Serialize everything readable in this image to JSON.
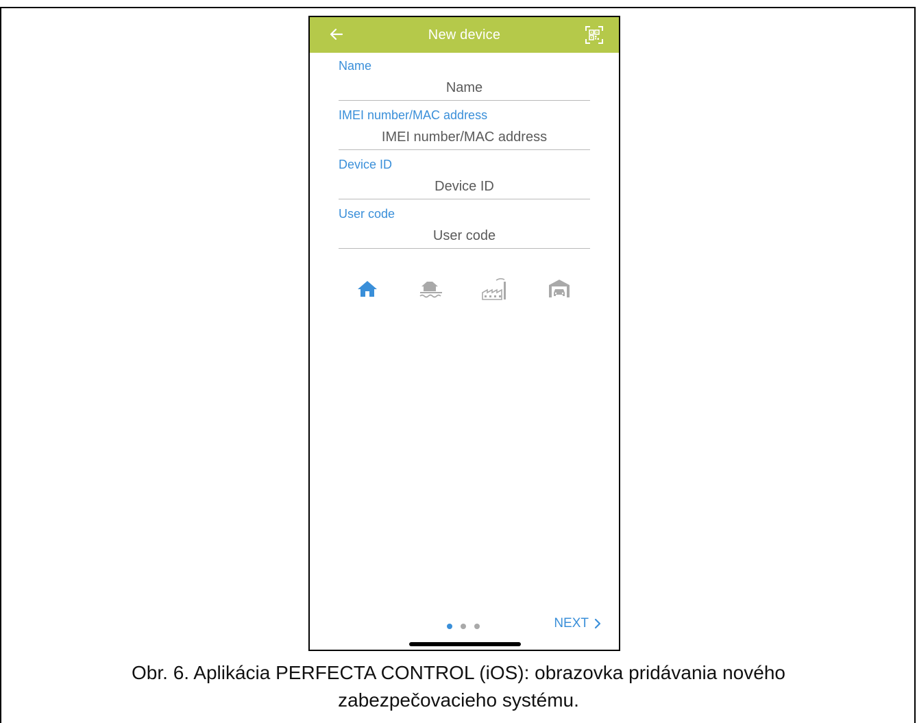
{
  "header": {
    "title": "New device",
    "back_icon": "arrow-left-icon",
    "qr_icon": "qr-scan-icon",
    "accent_color": "#b5c94a"
  },
  "form": {
    "fields": [
      {
        "label": "Name",
        "placeholder": "Name"
      },
      {
        "label": "IMEI number/MAC address",
        "placeholder": "IMEI number/MAC address"
      },
      {
        "label": "Device ID",
        "placeholder": "Device ID"
      },
      {
        "label": "User code",
        "placeholder": "User code"
      }
    ]
  },
  "object_types": [
    {
      "icon": "house-icon",
      "selected": true
    },
    {
      "icon": "lake-house-icon",
      "selected": false
    },
    {
      "icon": "factory-icon",
      "selected": false
    },
    {
      "icon": "garage-icon",
      "selected": false
    }
  ],
  "pager": {
    "count": 3,
    "active_index": 0
  },
  "footer": {
    "next_label": "NEXT"
  },
  "caption": {
    "line1": "Obr. 6. Aplikácia PERFECTA CONTROL (iOS): obrazovka pridávania nového",
    "line2": "zabezpečovacieho systému."
  },
  "colors": {
    "active_blue": "#3a8fd9",
    "inactive_gray": "#a9a9a9"
  }
}
